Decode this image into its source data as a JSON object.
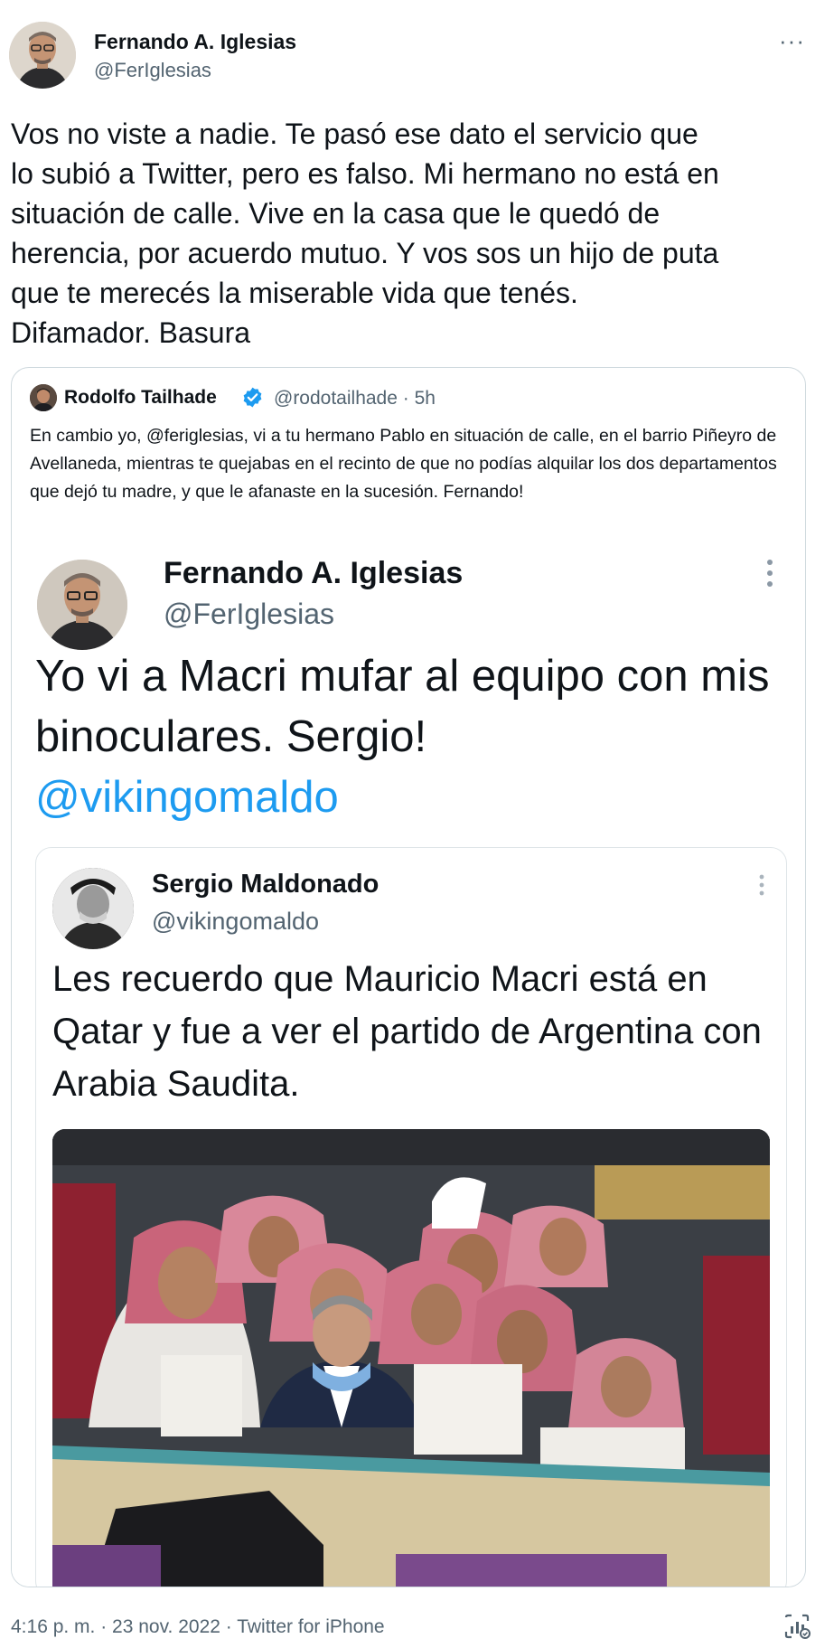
{
  "main_tweet": {
    "author_name": "Fernando A. Iglesias",
    "author_handle": "@FerIglesias",
    "more_label": "···",
    "text": "Vos no viste a nadie. Te pasó ese dato el servicio que\nlo subió a Twitter, pero es falso. Mi hermano no está en\nsituación de calle. Vive en la casa que le quedó de\nherencia, por acuerdo mutuo. Y vos sos un hijo de puta\nque te merecés la miserable vida que tenés.\nDifamador. Basura"
  },
  "quote": {
    "author_name": "Rodolfo Tailhade",
    "verified": true,
    "handle_time": "@rodotailhade · 5h",
    "text": "En cambio yo, @feriglesias, vi a tu hermano Pablo en situación de calle, en el barrio Piñeyro de Avellaneda, mientras te quejabas en el recinto de que no podías alquilar los dos departamentos que dejó tu madre, y que le afanaste en la sucesión. Fernando!"
  },
  "screenshot": {
    "author_name": "Fernando A. Iglesias",
    "author_handle": "@FerIglesias",
    "text": "Yo vi a Macri mufar al equipo con mis binoculares. Sergio!",
    "mention": "@vikingomaldo"
  },
  "nested_screenshot": {
    "author_name": "Sergio Maldonado",
    "author_handle": "@vikingomaldo",
    "text": "Les recuerdo que Mauricio Macri está en Qatar y fue a ver el partido de Argentina con Arabia Saudita."
  },
  "footer": {
    "meta": "4:16 p. m. · 23 nov. 2022 · Twitter for iPhone"
  },
  "icons": {
    "verified": "verified-badge-icon",
    "more": "more-icon",
    "analytics": "analytics-icon"
  },
  "colors": {
    "text": "#0f1419",
    "secondary": "#536471",
    "link": "#1d9bf0",
    "border": "#cfd9de"
  }
}
